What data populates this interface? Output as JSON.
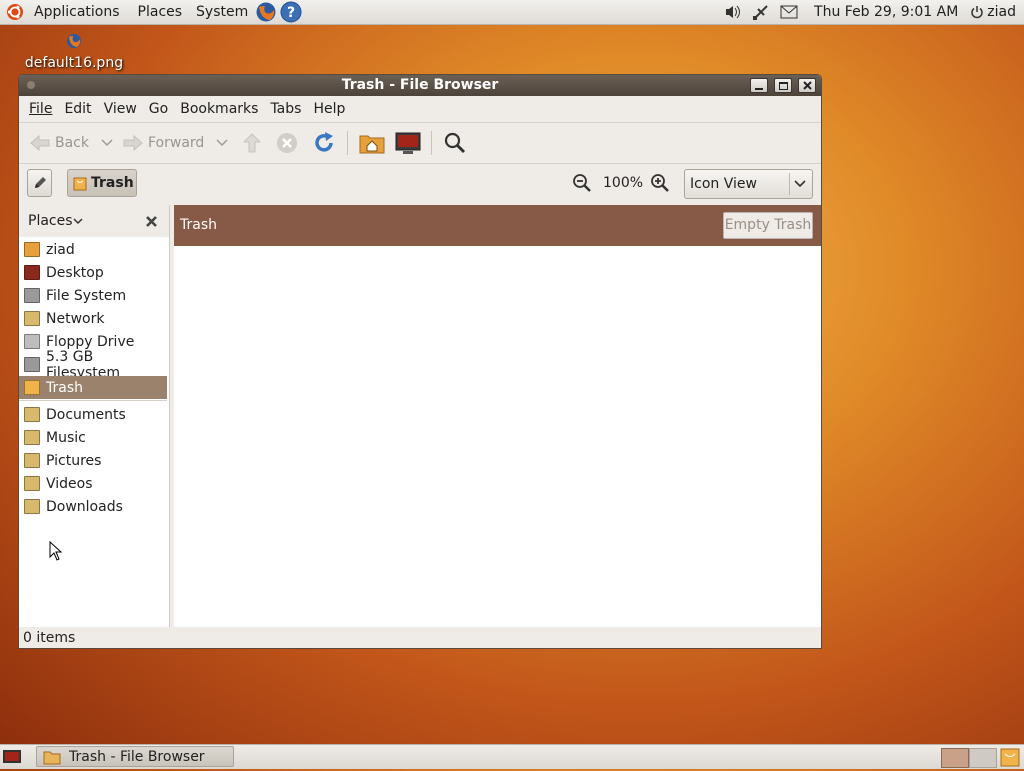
{
  "top_panel": {
    "menus": [
      "Applications",
      "Places",
      "System"
    ],
    "clock": "Thu Feb 29,  9:01 AM",
    "user": "ziad",
    "icons": [
      "ubuntu-logo-icon",
      "firefox-icon",
      "help-icon",
      "volume-icon",
      "network-icon",
      "mail-icon",
      "power-icon"
    ]
  },
  "desktop": {
    "icon_label": "default16.png"
  },
  "window": {
    "title": "Trash - File Browser",
    "menu": {
      "file": "File",
      "edit": "Edit",
      "view": "View",
      "go": "Go",
      "bookmarks": "Bookmarks",
      "tabs": "Tabs",
      "help": "Help"
    },
    "toolbar": {
      "back": "Back",
      "forward": "Forward"
    },
    "location": {
      "path_button": "Trash",
      "zoom": "100%",
      "view_mode": "Icon View"
    },
    "sidebar": {
      "title": "Places",
      "items": [
        {
          "label": "ziad",
          "icon": "home-folder-icon",
          "color": "#e7a13c"
        },
        {
          "label": "Desktop",
          "icon": "desktop-icon",
          "color": "#8a2a1c"
        },
        {
          "label": "File System",
          "icon": "harddisk-icon",
          "color": "#9a9a9a"
        },
        {
          "label": "Network",
          "icon": "network-folder-icon",
          "color": "#d8b86c"
        },
        {
          "label": "Floppy Drive",
          "icon": "floppy-icon",
          "color": "#bdbdbd"
        },
        {
          "label": "5.3 GB Filesystem",
          "icon": "harddisk-icon",
          "color": "#9a9a9a"
        },
        {
          "label": "Trash",
          "icon": "trash-icon",
          "color": "#f0b24a"
        }
      ],
      "bookmarks": [
        {
          "label": "Documents",
          "icon": "documents-folder-icon",
          "color": "#d8b86c"
        },
        {
          "label": "Music",
          "icon": "music-folder-icon",
          "color": "#d8b86c"
        },
        {
          "label": "Pictures",
          "icon": "pictures-folder-icon",
          "color": "#d8b86c"
        },
        {
          "label": "Videos",
          "icon": "videos-folder-icon",
          "color": "#d8b86c"
        },
        {
          "label": "Downloads",
          "icon": "downloads-folder-icon",
          "color": "#d8b86c"
        }
      ]
    },
    "content": {
      "location_label": "Trash",
      "empty_trash_button": "Empty Trash"
    },
    "status": "0 items"
  },
  "taskbar": {
    "task": "Trash - File Browser"
  },
  "colors": {
    "accent": "#875a47",
    "selection": "#9b826d",
    "titlebar": "#4c433b"
  }
}
